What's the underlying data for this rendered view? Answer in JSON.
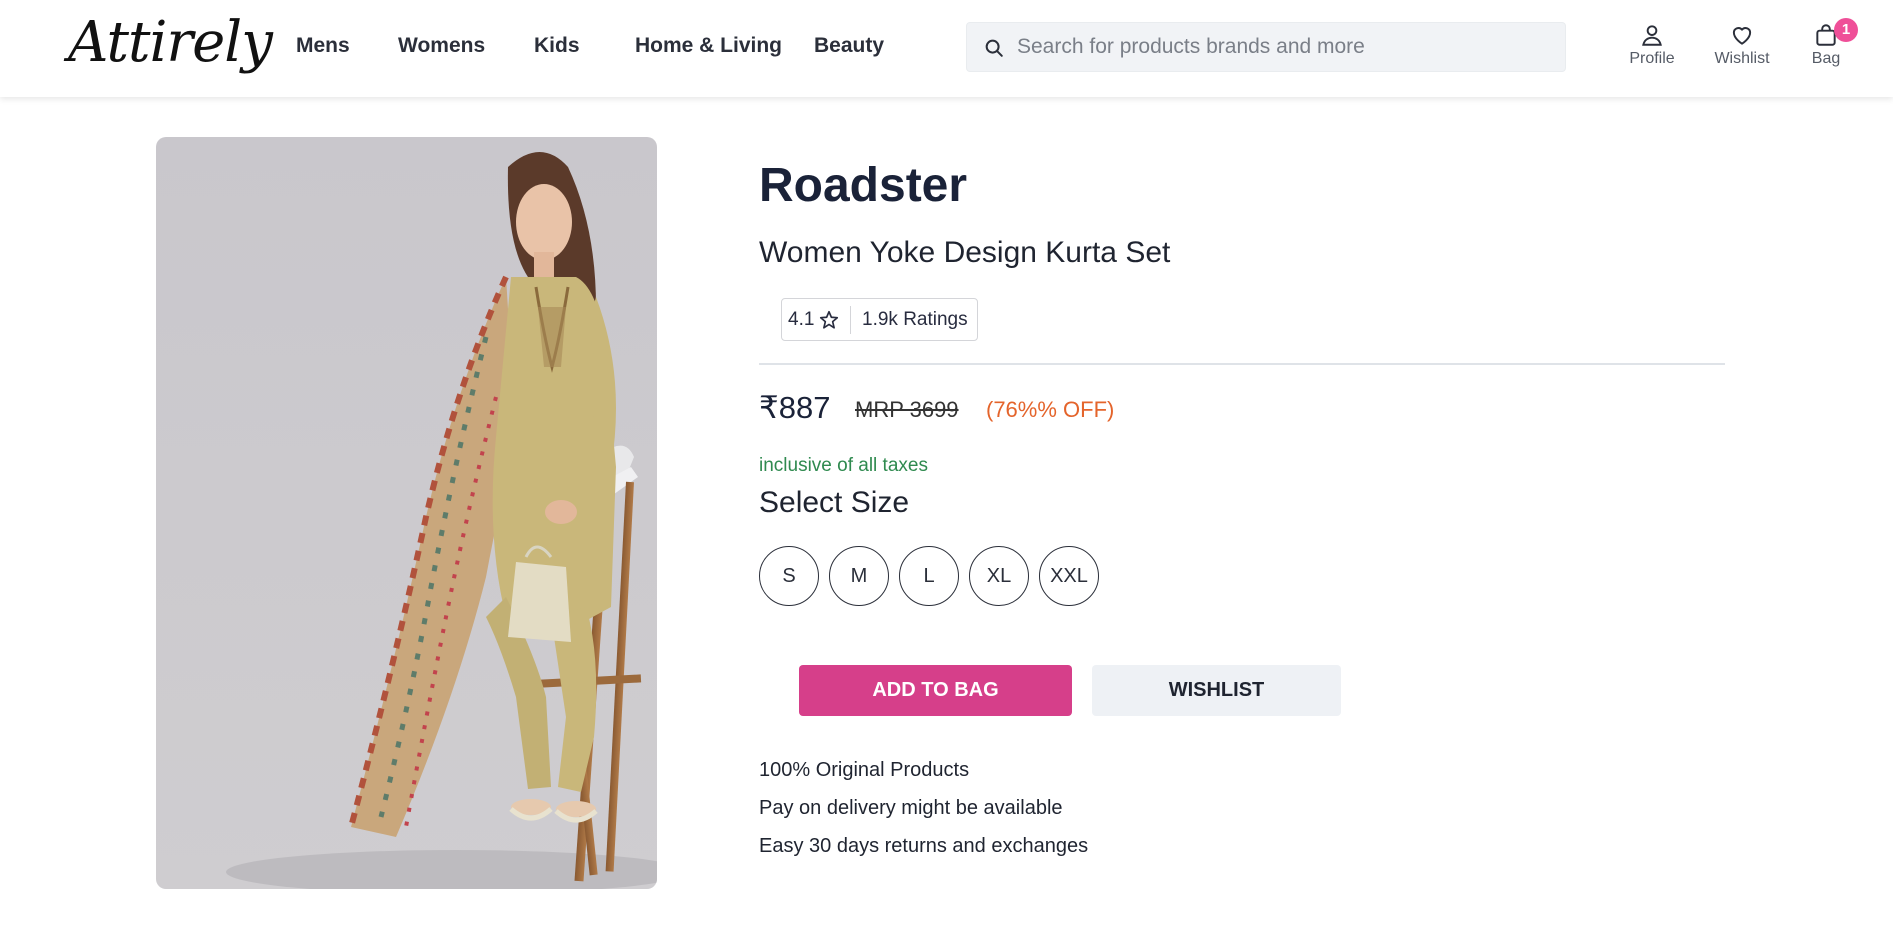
{
  "header": {
    "logo": "Attirely",
    "nav": [
      "Mens",
      "Womens",
      "Kids",
      "Home & Living",
      "Beauty"
    ],
    "search_placeholder": "Search for products brands and more",
    "actions": {
      "profile": "Profile",
      "wishlist": "Wishlist",
      "bag": "Bag",
      "bag_count": "1"
    }
  },
  "product": {
    "brand": "Roadster",
    "name": "Women Yoke Design Kurta Set",
    "rating": "4.1",
    "ratings_count": "1.9k Ratings",
    "price": "₹887",
    "mrp": "MRP 3699",
    "discount": "(76%% OFF)",
    "tax_note": "inclusive of all taxes",
    "size_title": "Select Size",
    "sizes": [
      "S",
      "M",
      "L",
      "XL",
      "XXL"
    ],
    "add_to_bag": "ADD TO BAG",
    "wishlist": "WISHLIST",
    "features": [
      "100% Original Products",
      "Pay on delivery might be available",
      "Easy 30 days returns and exchanges"
    ]
  },
  "colors": {
    "accent": "#d63f8a",
    "badge": "#ef4f98",
    "discount": "#e4642b",
    "tax_note": "#2f8a4f"
  },
  "icons": {
    "search": "search-icon",
    "profile": "profile-icon",
    "wishlist": "heart-icon",
    "bag": "bag-icon",
    "rating": "star-icon"
  }
}
